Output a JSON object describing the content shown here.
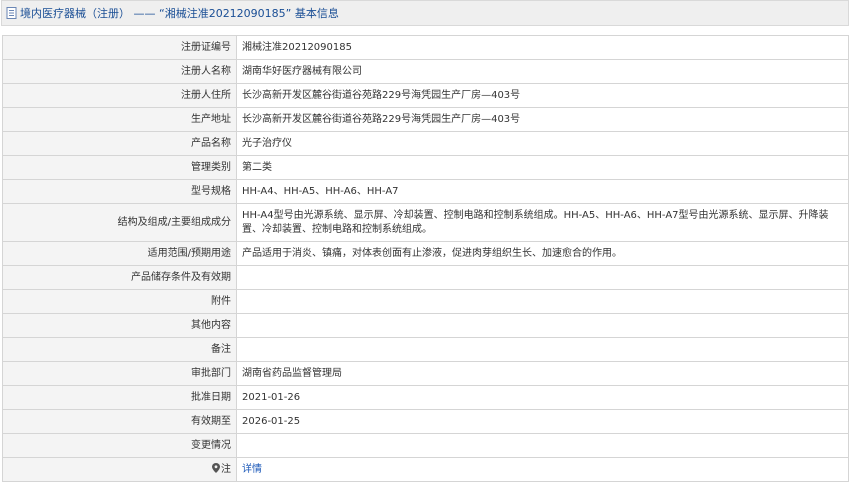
{
  "header": {
    "title": "境内医疗器械（注册） —— “湘械注准20212090185” 基本信息"
  },
  "rows": [
    {
      "label": "注册证编号",
      "value": "湘械注准20212090185"
    },
    {
      "label": "注册人名称",
      "value": "湖南华好医疗器械有限公司"
    },
    {
      "label": "注册人住所",
      "value": "长沙高新开发区麓谷街道谷苑路229号海凭园生产厂房—403号"
    },
    {
      "label": "生产地址",
      "value": "长沙高新开发区麓谷街道谷苑路229号海凭园生产厂房—403号"
    },
    {
      "label": "产品名称",
      "value": "光子治疗仪"
    },
    {
      "label": "管理类别",
      "value": "第二类"
    },
    {
      "label": "型号规格",
      "value": "HH-A4、HH-A5、HH-A6、HH-A7"
    },
    {
      "label": "结构及组成/主要组成成分",
      "value": "HH-A4型号由光源系统、显示屏、冷却装置、控制电路和控制系统组成。HH-A5、HH-A6、HH-A7型号由光源系统、显示屏、升降装置、冷却装置、控制电路和控制系统组成。"
    },
    {
      "label": "适用范围/预期用途",
      "value": "产品适用于消炎、镇痛，对体表创面有止渗液，促进肉芽组织生长、加速愈合的作用。"
    },
    {
      "label": "产品储存条件及有效期",
      "value": ""
    },
    {
      "label": "附件",
      "value": ""
    },
    {
      "label": "其他内容",
      "value": ""
    },
    {
      "label": "备注",
      "value": ""
    },
    {
      "label": "审批部门",
      "value": "湖南省药品监督管理局"
    },
    {
      "label": "批准日期",
      "value": "2021-01-26"
    },
    {
      "label": "有效期至",
      "value": "2026-01-25"
    },
    {
      "label": "变更情况",
      "value": ""
    }
  ],
  "footer_row": {
    "label": "注",
    "link_text": "详情"
  },
  "colors": {
    "title_text": "#1a4e95",
    "link": "#1a57b8",
    "label_bg": "#f4f4f4",
    "border": "#d5d5d5"
  }
}
